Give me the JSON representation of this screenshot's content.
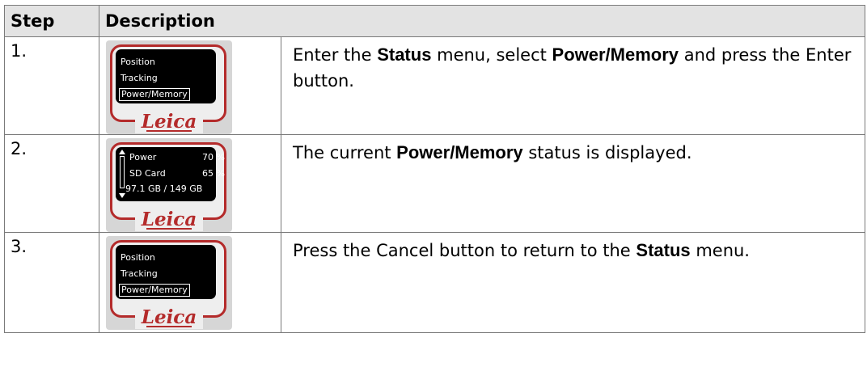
{
  "headers": {
    "step": "Step",
    "description": "Description"
  },
  "rows": [
    {
      "step": "1.",
      "device": {
        "type": "menu",
        "items": [
          "Position",
          "Tracking",
          "Power/Memory"
        ],
        "selected": "Power/Memory",
        "logo": "Leica"
      },
      "text": [
        "Enter the ",
        "Status",
        " menu, select ",
        "Power/Memory",
        " and press the Enter button."
      ]
    },
    {
      "step": "2.",
      "device": {
        "type": "status",
        "power_label": "Power",
        "power_value": "70 %",
        "sd_label": "SD Card",
        "sd_value": "65 %",
        "storage": "97.1 GB / 149 GB",
        "logo": "Leica"
      },
      "text": [
        "The current ",
        "Power/Memory",
        " status is displayed."
      ]
    },
    {
      "step": "3.",
      "device": {
        "type": "menu",
        "items": [
          "Position",
          "Tracking",
          "Power/Memory"
        ],
        "selected": "Power/Memory",
        "logo": "Leica"
      },
      "text": [
        "Press the Cancel button to return to the ",
        "Status",
        " menu."
      ]
    }
  ],
  "colors": {
    "frame": "#b42b2b",
    "header_bg": "#e3e3e3",
    "border": "#7a7a7a",
    "screen": "#000000"
  }
}
